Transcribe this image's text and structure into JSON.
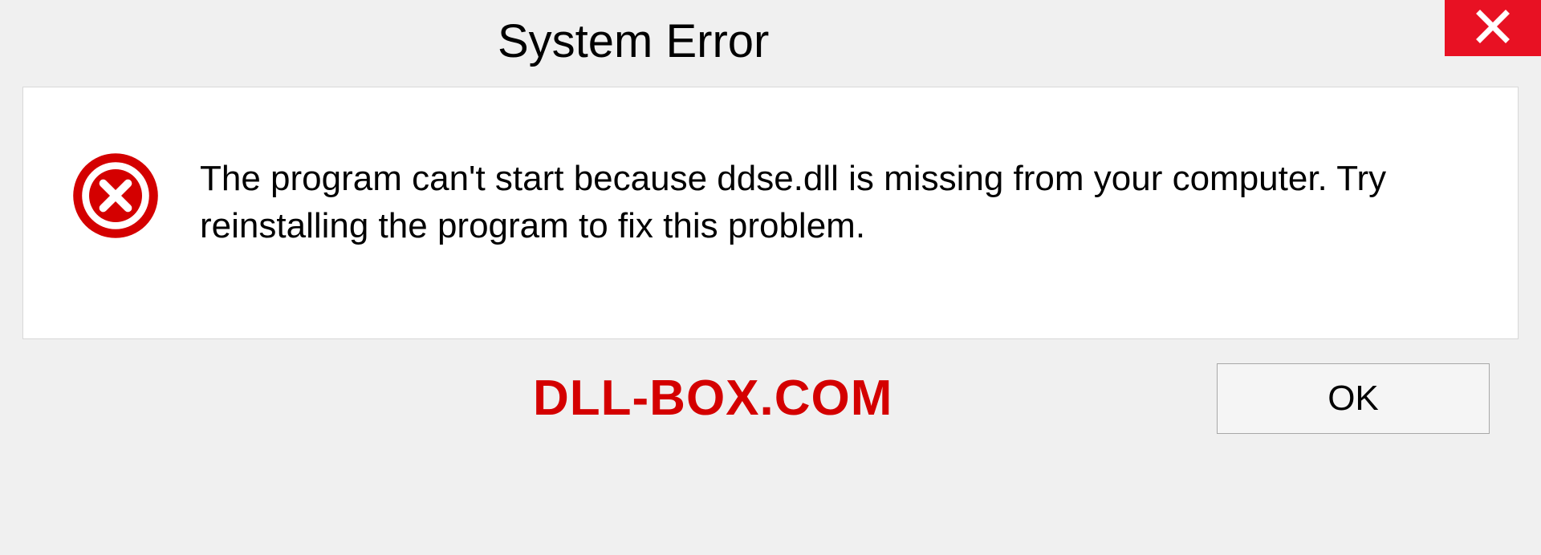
{
  "dialog": {
    "title": "System Error",
    "message": "The program can't start because ddse.dll is missing from your computer. Try reinstalling the program to fix this problem.",
    "ok_label": "OK"
  },
  "brand": {
    "label": "DLL-BOX.COM"
  },
  "colors": {
    "close_bg": "#e81123",
    "error_icon": "#d40000",
    "brand": "#d40000"
  }
}
